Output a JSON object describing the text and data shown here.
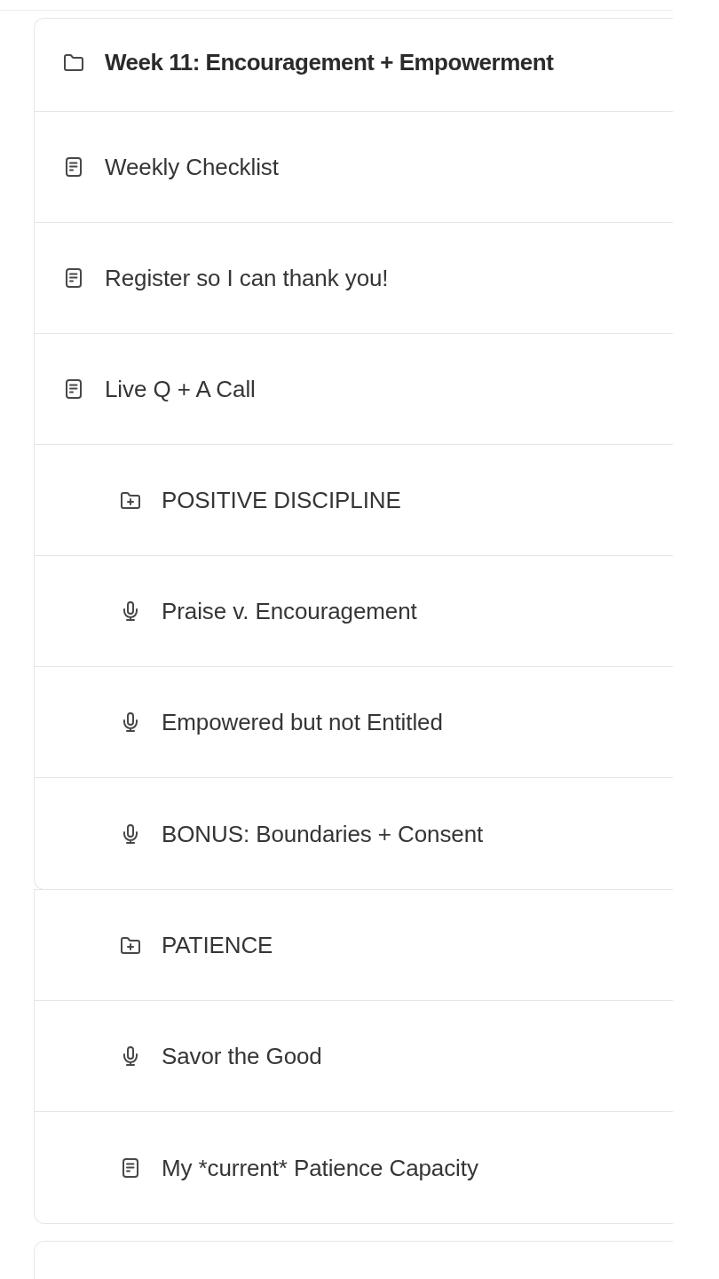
{
  "outline": {
    "cards": [
      {
        "title": "Week 11: Encouragement + Empowerment",
        "items": [
          {
            "kind": "page",
            "title": "Weekly Checklist"
          },
          {
            "kind": "page",
            "title": "Register so I can thank you!"
          },
          {
            "kind": "page",
            "title": "Live Q + A Call"
          },
          {
            "kind": "section",
            "title": "POSITIVE DISCIPLINE",
            "children": [
              {
                "kind": "audio",
                "title": "Praise v. Encouragement"
              },
              {
                "kind": "audio",
                "title": "Empowered but not Entitled"
              },
              {
                "kind": "audio",
                "title": "BONUS: Boundaries + Consent"
              }
            ]
          }
        ]
      },
      {
        "items": [
          {
            "kind": "section",
            "title": "PATIENCE",
            "children": [
              {
                "kind": "audio",
                "title": "Savor the Good"
              },
              {
                "kind": "page",
                "title": "My *current* Patience Capacity"
              }
            ]
          }
        ]
      }
    ]
  }
}
